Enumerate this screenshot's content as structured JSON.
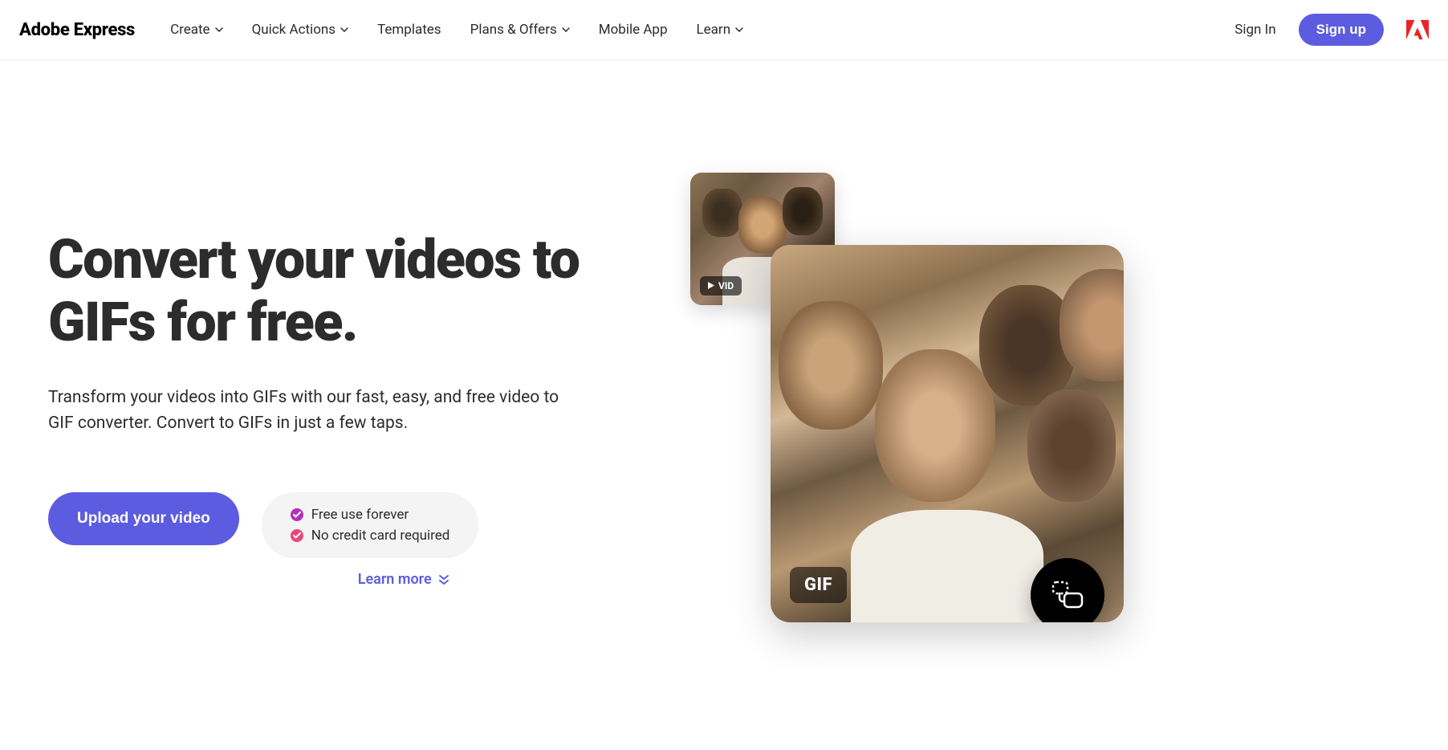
{
  "header": {
    "logo": "Adobe Express",
    "nav": [
      {
        "label": "Create",
        "hasDropdown": true
      },
      {
        "label": "Quick Actions",
        "hasDropdown": true
      },
      {
        "label": "Templates",
        "hasDropdown": false
      },
      {
        "label": "Plans & Offers",
        "hasDropdown": true
      },
      {
        "label": "Mobile App",
        "hasDropdown": false
      },
      {
        "label": "Learn",
        "hasDropdown": true
      }
    ],
    "signIn": "Sign In",
    "signUp": "Sign up"
  },
  "hero": {
    "title": "Convert your videos to GIFs for free.",
    "subtitle": "Transform your videos into GIFs with our fast, easy, and free video to GIF converter. Convert to GIFs in just a few taps.",
    "cta": "Upload your video",
    "benefits": [
      "Free use forever",
      "No credit card required"
    ],
    "learnMore": "Learn more",
    "vidBadge": "VID",
    "gifBadge": "GIF"
  }
}
